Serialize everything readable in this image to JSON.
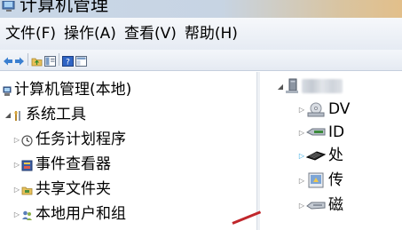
{
  "window": {
    "title": "计算机管理"
  },
  "menu": {
    "items": [
      {
        "label": "文件(F)"
      },
      {
        "label": "操作(A)"
      },
      {
        "label": "查看(V)"
      },
      {
        "label": "帮助(H)"
      }
    ]
  },
  "toolbar": {
    "icons": [
      "back-arrow-icon",
      "forward-arrow-icon",
      "up-folder-icon",
      "show-hide-tree-icon",
      "help-icon",
      "console-pane-icon"
    ]
  },
  "tree": {
    "root": {
      "label": "计算机管理(本地)",
      "icon": "computer-management-icon"
    },
    "system_tools": {
      "label": "系统工具",
      "icon": "system-tools-icon"
    },
    "children": [
      {
        "label": "任务计划程序",
        "icon": "clock-icon"
      },
      {
        "label": "事件查看器",
        "icon": "event-viewer-icon"
      },
      {
        "label": "共享文件夹",
        "icon": "shared-folder-icon"
      },
      {
        "label": "本地用户和组",
        "icon": "users-icon"
      }
    ]
  },
  "devices": {
    "items": [
      {
        "label": "DV",
        "icon": "dvd-drive-icon"
      },
      {
        "label": "ID",
        "icon": "ide-controller-icon"
      },
      {
        "label": "处",
        "icon": "processor-icon"
      },
      {
        "label": "传",
        "icon": "sensor-icon"
      },
      {
        "label": "磁",
        "icon": "disk-drive-icon"
      }
    ]
  },
  "colors": {
    "accent_arrow": "#27a4e0",
    "annotation_red": "#c0262b"
  }
}
